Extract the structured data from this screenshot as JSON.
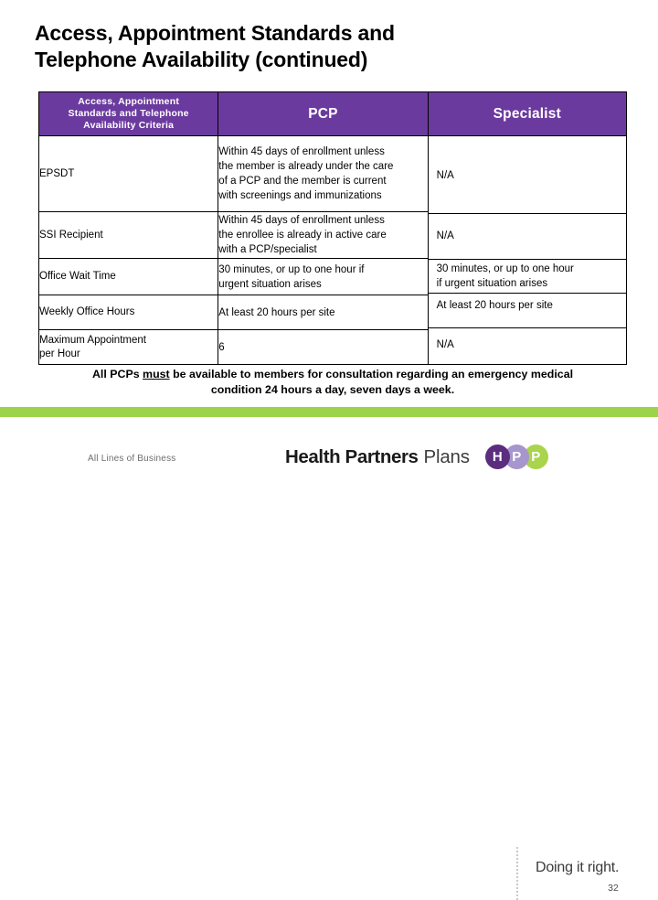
{
  "slide": {
    "title_line1": "Access, Appointment Standards and",
    "title_line2": "Telephone Availability (continued)",
    "page_number": "32"
  },
  "table": {
    "headers": {
      "criteria_line1": "Access, Appointment",
      "criteria_line2": "Standards and Telephone",
      "criteria_line3": "Availability Criteria",
      "pcp": "PCP",
      "specialist": "Specialist"
    },
    "rows": [
      {
        "criteria": "EPSDT",
        "pcp_line1": "Within 45 days of enrollment unless",
        "pcp_line2": "the member is already under the care",
        "pcp_line3": "of a PCP and the member is current",
        "pcp_line4": "with screenings and immunizations",
        "specialist": "N/A"
      },
      {
        "criteria": "SSI Recipient",
        "pcp_line1": "Within 45 days of enrollment unless",
        "pcp_line2": "the enrollee is already in active care",
        "pcp_line3": "with a PCP/specialist",
        "specialist": "N/A"
      },
      {
        "criteria": "Office Wait Time",
        "pcp_line1": "30 minutes, or up to one hour if",
        "pcp_line2": "urgent situation arises",
        "spec_line1": "30 minutes, or up to one hour",
        "spec_line2": "if urgent situation arises"
      },
      {
        "criteria": "Weekly Office Hours",
        "pcp_line1": "At least 20 hours per site",
        "specialist": "At least 20 hours per site"
      },
      {
        "criteria_line1": "Maximum Appointment",
        "criteria_line2": "per Hour",
        "pcp_line1": "6",
        "specialist": "N/A"
      }
    ]
  },
  "note": {
    "line1_before": "All PCPs ",
    "line1_emphasis": "must",
    "line1_after": " be available to members for consultation regarding an emergency medical",
    "line2": "condition 24 hours a day, seven days a week."
  },
  "footer": {
    "all_lines_of_business": "All Lines of Business",
    "logo_health_partners": "Health Partners",
    "logo_plans": "Plans",
    "circle_h": "H",
    "circle_p1": "P",
    "circle_p2": "P",
    "tagline": "Doing it right."
  },
  "colors": {
    "header_purple": "#6B3A9E",
    "accent_green": "#9BD44B",
    "logo_dark_purple": "#5B2D7F",
    "logo_light_purple": "#A795CE",
    "logo_lime": "#A9D44B"
  }
}
